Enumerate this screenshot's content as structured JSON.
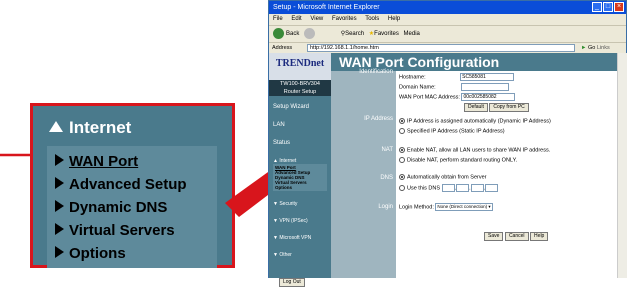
{
  "callout": {
    "heading": "Internet",
    "items": [
      {
        "label": "WAN Port",
        "active": true
      },
      {
        "label": "Advanced Setup"
      },
      {
        "label": "Dynamic DNS"
      },
      {
        "label": "Virtual Servers"
      },
      {
        "label": "Options"
      }
    ]
  },
  "browser": {
    "title": "Setup - Microsoft Internet Explorer",
    "menu": [
      "File",
      "Edit",
      "View",
      "Favorites",
      "Tools",
      "Help"
    ],
    "toolbar": {
      "back": "Back",
      "search": "Search",
      "favorites": "Favorites",
      "media": "Media"
    },
    "address_label": "Address",
    "address": "http://192.168.1.1/home.htm",
    "go": "Go",
    "links": "Links"
  },
  "router": {
    "logo": "TRENDnet",
    "model": "TW100-BRV304",
    "model_sub": "Router Setup",
    "nav": [
      "Setup Wizard",
      "LAN",
      "Status"
    ],
    "internet_heading": "Internet",
    "internet_items": [
      "WAN Port",
      "Advanced Setup",
      "Dynamic DNS",
      "Virtual Servers",
      "Options"
    ],
    "nav2": [
      "Security",
      "VPN (IPSec)",
      "Microsoft VPN",
      "Other"
    ],
    "logout": "Log Out"
  },
  "page": {
    "title": "WAN Port Configuration",
    "identification_label": "Identification",
    "hostname_label": "Hostname:",
    "hostname_value": "SC585081",
    "domain_label": "Domain Name:",
    "domain_value": "",
    "mac_label": "WAN Port MAC Address:",
    "mac_value": "00c002585082",
    "default_btn": "Default",
    "copy_btn": "Copy from PC",
    "ip_label": "IP Address",
    "ip_opt1": "IP Address is assigned automatically (Dynamic IP Address)",
    "ip_opt2": "Specified IP Address (Static IP Address)",
    "nat_label": "NAT",
    "nat_opt1": "Enable NAT, allow all LAN users to share WAN IP address.",
    "nat_opt2": "Disable NAT, perform standard routing ONLY.",
    "dns_label": "DNS",
    "dns_opt1": "Automatically obtain from Server",
    "dns_opt2": "Use this DNS",
    "login_label": "Login",
    "login_method_label": "Login Method:",
    "login_method_value": "None (Direct connection)",
    "save": "Save",
    "cancel": "Cancel",
    "help": "Help"
  }
}
